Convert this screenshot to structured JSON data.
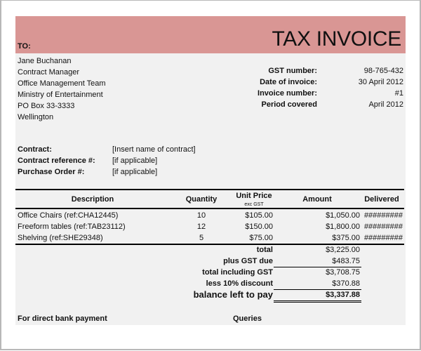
{
  "header": {
    "to_label": "TO:",
    "title": "TAX INVOICE",
    "banner_color": "#d99694"
  },
  "recipient": [
    "Jane Buchanan",
    "Contract Manager",
    "Office Management Team",
    "Ministry of Entertainment",
    "PO Box 33-3333",
    "Wellington"
  ],
  "invoice_info": [
    {
      "label": "GST number:",
      "value": "98-765-432"
    },
    {
      "label": "Date of invoice:",
      "value": "30 April 2012"
    },
    {
      "label": "Invoice number:",
      "value": "#1"
    },
    {
      "label": "Period covered",
      "value": "April 2012"
    }
  ],
  "contract": [
    {
      "label": "Contract:",
      "value": "[Insert name of contract]"
    },
    {
      "label": "Contract reference #:",
      "value": "[if applicable]"
    },
    {
      "label": "Purchase Order #:",
      "value": "[if applicable]"
    }
  ],
  "table": {
    "headers": {
      "description": "Description",
      "quantity": "Quantity",
      "unit_price": "Unit Price",
      "unit_price_note": "exc GST",
      "amount": "Amount",
      "delivered": "Delivered"
    },
    "rows": [
      {
        "description": "Office Chairs (ref:CHA12445)",
        "quantity": "10",
        "unit_price": "$105.00",
        "amount": "$1,050.00",
        "delivered": "#########"
      },
      {
        "description": "Freeform tables (ref:TAB23112)",
        "quantity": "12",
        "unit_price": "$150.00",
        "amount": "$1,800.00",
        "delivered": "#########"
      },
      {
        "description": "Shelving (ref:SHE29348)",
        "quantity": "5",
        "unit_price": "$75.00",
        "amount": "$375.00",
        "delivered": "#########"
      }
    ]
  },
  "totals": [
    {
      "label": "total",
      "value": "$3,225.00"
    },
    {
      "label": "plus GST due",
      "value": "$483.75"
    },
    {
      "label": "total including GST",
      "value": "$3,708.75"
    },
    {
      "label": "less 10% discount",
      "value": "$370.88"
    },
    {
      "label": "balance left to pay",
      "value": "$3,337.88"
    }
  ],
  "footer": {
    "bank_label": "For direct bank payment",
    "queries_label": "Queries"
  }
}
